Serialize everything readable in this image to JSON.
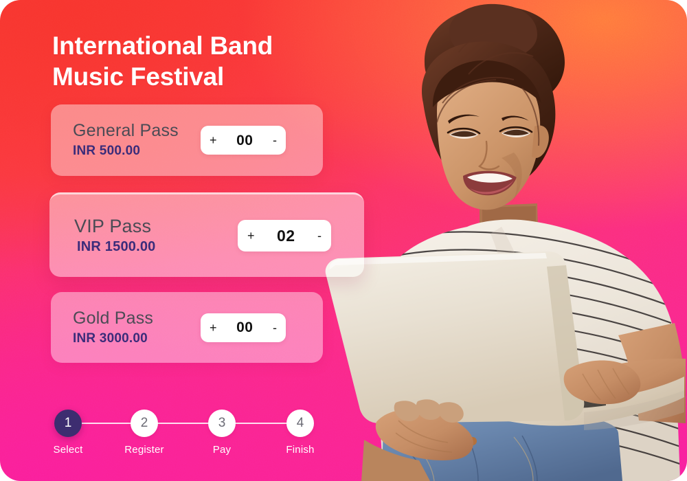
{
  "theme": {
    "gradient_top_left": "#f8342e",
    "gradient_top_right": "#ff7a3c",
    "gradient_bottom": "#f81fa0",
    "accent_price": "#3b2c7a",
    "active_step": "#3d2d70",
    "card_surface": "rgba(255,255,255,0.42)"
  },
  "headline": {
    "title": "International Band\nMusic Festival"
  },
  "passes": [
    {
      "name": "General Pass",
      "price": "INR 500.00",
      "quantity": "00",
      "increment": "+",
      "decrement": "-",
      "selected": false
    },
    {
      "name": "VIP Pass",
      "price": "INR 1500.00",
      "quantity": "02",
      "increment": "+",
      "decrement": "-",
      "selected": true
    },
    {
      "name": "Gold Pass",
      "price": "INR 3000.00",
      "quantity": "00",
      "increment": "+",
      "decrement": "-",
      "selected": false
    }
  ],
  "progress": {
    "steps": [
      {
        "number": "1",
        "label": "Select",
        "active": true
      },
      {
        "number": "2",
        "label": "Register",
        "active": false
      },
      {
        "number": "3",
        "label": "Pay",
        "active": false
      },
      {
        "number": "4",
        "label": "Finish",
        "active": false
      }
    ]
  },
  "photo": {
    "description": "woman-with-laptop-photo"
  }
}
